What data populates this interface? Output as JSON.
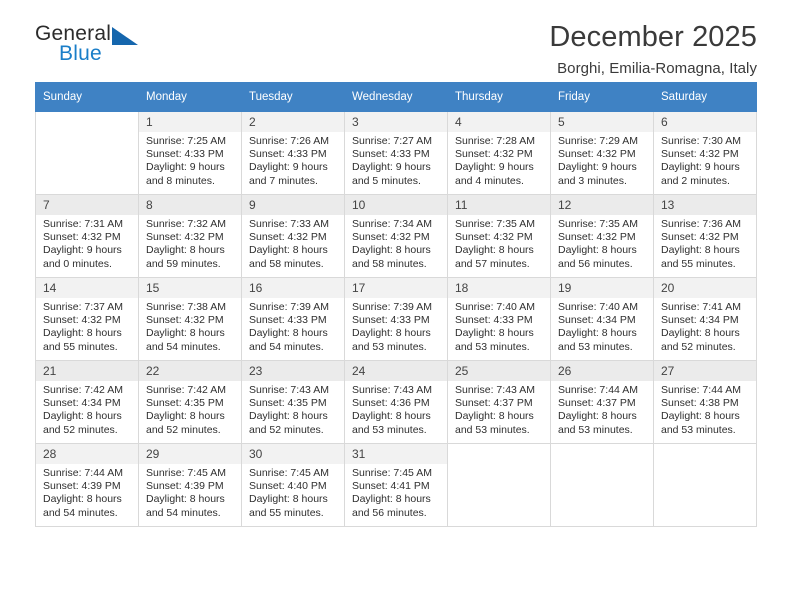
{
  "brand": {
    "name_top": "General",
    "name_bottom": "Blue",
    "accent_color": "#1a7ec8",
    "triangle_color": "#1566ad"
  },
  "header": {
    "title": "December 2025",
    "subtitle": "Borghi, Emilia-Romagna, Italy"
  },
  "calendar": {
    "header_bg": "#3f82c4",
    "weekdays": [
      "Sunday",
      "Monday",
      "Tuesday",
      "Wednesday",
      "Thursday",
      "Friday",
      "Saturday"
    ],
    "weeks": [
      [
        {
          "day": ""
        },
        {
          "day": "1",
          "sunrise": "Sunrise: 7:25 AM",
          "sunset": "Sunset: 4:33 PM",
          "daylight1": "Daylight: 9 hours",
          "daylight2": "and 8 minutes."
        },
        {
          "day": "2",
          "sunrise": "Sunrise: 7:26 AM",
          "sunset": "Sunset: 4:33 PM",
          "daylight1": "Daylight: 9 hours",
          "daylight2": "and 7 minutes."
        },
        {
          "day": "3",
          "sunrise": "Sunrise: 7:27 AM",
          "sunset": "Sunset: 4:33 PM",
          "daylight1": "Daylight: 9 hours",
          "daylight2": "and 5 minutes."
        },
        {
          "day": "4",
          "sunrise": "Sunrise: 7:28 AM",
          "sunset": "Sunset: 4:32 PM",
          "daylight1": "Daylight: 9 hours",
          "daylight2": "and 4 minutes."
        },
        {
          "day": "5",
          "sunrise": "Sunrise: 7:29 AM",
          "sunset": "Sunset: 4:32 PM",
          "daylight1": "Daylight: 9 hours",
          "daylight2": "and 3 minutes."
        },
        {
          "day": "6",
          "sunrise": "Sunrise: 7:30 AM",
          "sunset": "Sunset: 4:32 PM",
          "daylight1": "Daylight: 9 hours",
          "daylight2": "and 2 minutes."
        }
      ],
      [
        {
          "day": "7",
          "sunrise": "Sunrise: 7:31 AM",
          "sunset": "Sunset: 4:32 PM",
          "daylight1": "Daylight: 9 hours",
          "daylight2": "and 0 minutes."
        },
        {
          "day": "8",
          "sunrise": "Sunrise: 7:32 AM",
          "sunset": "Sunset: 4:32 PM",
          "daylight1": "Daylight: 8 hours",
          "daylight2": "and 59 minutes."
        },
        {
          "day": "9",
          "sunrise": "Sunrise: 7:33 AM",
          "sunset": "Sunset: 4:32 PM",
          "daylight1": "Daylight: 8 hours",
          "daylight2": "and 58 minutes."
        },
        {
          "day": "10",
          "sunrise": "Sunrise: 7:34 AM",
          "sunset": "Sunset: 4:32 PM",
          "daylight1": "Daylight: 8 hours",
          "daylight2": "and 58 minutes."
        },
        {
          "day": "11",
          "sunrise": "Sunrise: 7:35 AM",
          "sunset": "Sunset: 4:32 PM",
          "daylight1": "Daylight: 8 hours",
          "daylight2": "and 57 minutes."
        },
        {
          "day": "12",
          "sunrise": "Sunrise: 7:35 AM",
          "sunset": "Sunset: 4:32 PM",
          "daylight1": "Daylight: 8 hours",
          "daylight2": "and 56 minutes."
        },
        {
          "day": "13",
          "sunrise": "Sunrise: 7:36 AM",
          "sunset": "Sunset: 4:32 PM",
          "daylight1": "Daylight: 8 hours",
          "daylight2": "and 55 minutes."
        }
      ],
      [
        {
          "day": "14",
          "sunrise": "Sunrise: 7:37 AM",
          "sunset": "Sunset: 4:32 PM",
          "daylight1": "Daylight: 8 hours",
          "daylight2": "and 55 minutes."
        },
        {
          "day": "15",
          "sunrise": "Sunrise: 7:38 AM",
          "sunset": "Sunset: 4:32 PM",
          "daylight1": "Daylight: 8 hours",
          "daylight2": "and 54 minutes."
        },
        {
          "day": "16",
          "sunrise": "Sunrise: 7:39 AM",
          "sunset": "Sunset: 4:33 PM",
          "daylight1": "Daylight: 8 hours",
          "daylight2": "and 54 minutes."
        },
        {
          "day": "17",
          "sunrise": "Sunrise: 7:39 AM",
          "sunset": "Sunset: 4:33 PM",
          "daylight1": "Daylight: 8 hours",
          "daylight2": "and 53 minutes."
        },
        {
          "day": "18",
          "sunrise": "Sunrise: 7:40 AM",
          "sunset": "Sunset: 4:33 PM",
          "daylight1": "Daylight: 8 hours",
          "daylight2": "and 53 minutes."
        },
        {
          "day": "19",
          "sunrise": "Sunrise: 7:40 AM",
          "sunset": "Sunset: 4:34 PM",
          "daylight1": "Daylight: 8 hours",
          "daylight2": "and 53 minutes."
        },
        {
          "day": "20",
          "sunrise": "Sunrise: 7:41 AM",
          "sunset": "Sunset: 4:34 PM",
          "daylight1": "Daylight: 8 hours",
          "daylight2": "and 52 minutes."
        }
      ],
      [
        {
          "day": "21",
          "sunrise": "Sunrise: 7:42 AM",
          "sunset": "Sunset: 4:34 PM",
          "daylight1": "Daylight: 8 hours",
          "daylight2": "and 52 minutes."
        },
        {
          "day": "22",
          "sunrise": "Sunrise: 7:42 AM",
          "sunset": "Sunset: 4:35 PM",
          "daylight1": "Daylight: 8 hours",
          "daylight2": "and 52 minutes."
        },
        {
          "day": "23",
          "sunrise": "Sunrise: 7:43 AM",
          "sunset": "Sunset: 4:35 PM",
          "daylight1": "Daylight: 8 hours",
          "daylight2": "and 52 minutes."
        },
        {
          "day": "24",
          "sunrise": "Sunrise: 7:43 AM",
          "sunset": "Sunset: 4:36 PM",
          "daylight1": "Daylight: 8 hours",
          "daylight2": "and 53 minutes."
        },
        {
          "day": "25",
          "sunrise": "Sunrise: 7:43 AM",
          "sunset": "Sunset: 4:37 PM",
          "daylight1": "Daylight: 8 hours",
          "daylight2": "and 53 minutes."
        },
        {
          "day": "26",
          "sunrise": "Sunrise: 7:44 AM",
          "sunset": "Sunset: 4:37 PM",
          "daylight1": "Daylight: 8 hours",
          "daylight2": "and 53 minutes."
        },
        {
          "day": "27",
          "sunrise": "Sunrise: 7:44 AM",
          "sunset": "Sunset: 4:38 PM",
          "daylight1": "Daylight: 8 hours",
          "daylight2": "and 53 minutes."
        }
      ],
      [
        {
          "day": "28",
          "sunrise": "Sunrise: 7:44 AM",
          "sunset": "Sunset: 4:39 PM",
          "daylight1": "Daylight: 8 hours",
          "daylight2": "and 54 minutes."
        },
        {
          "day": "29",
          "sunrise": "Sunrise: 7:45 AM",
          "sunset": "Sunset: 4:39 PM",
          "daylight1": "Daylight: 8 hours",
          "daylight2": "and 54 minutes."
        },
        {
          "day": "30",
          "sunrise": "Sunrise: 7:45 AM",
          "sunset": "Sunset: 4:40 PM",
          "daylight1": "Daylight: 8 hours",
          "daylight2": "and 55 minutes."
        },
        {
          "day": "31",
          "sunrise": "Sunrise: 7:45 AM",
          "sunset": "Sunset: 4:41 PM",
          "daylight1": "Daylight: 8 hours",
          "daylight2": "and 56 minutes."
        },
        {
          "day": ""
        },
        {
          "day": ""
        },
        {
          "day": ""
        }
      ]
    ]
  }
}
